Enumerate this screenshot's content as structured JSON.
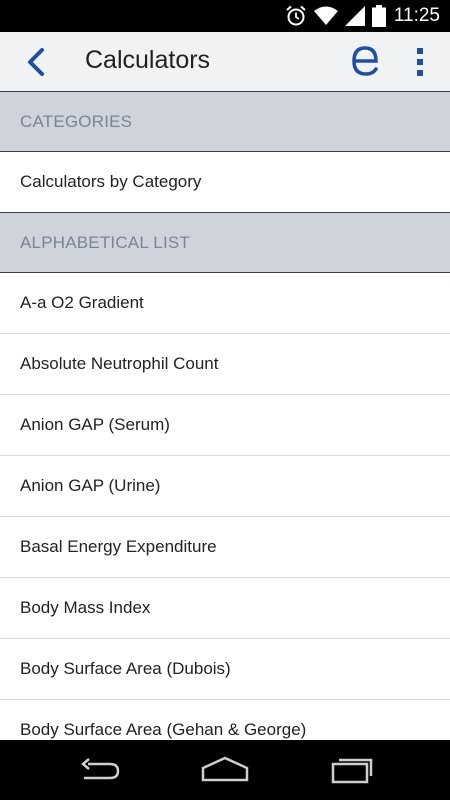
{
  "status_bar": {
    "time": "11:25",
    "icons": [
      "alarm-icon",
      "wifi-icon",
      "signal-icon",
      "battery-icon"
    ]
  },
  "app_bar": {
    "title": "Calculators",
    "back_icon": "chevron-left-icon",
    "brand_icon": "epocrates-e-icon",
    "menu_icon": "overflow-menu-icon",
    "accent_color": "#1f4fa0"
  },
  "sections": {
    "categories": {
      "header": "CATEGORIES",
      "items": [
        "Calculators by Category"
      ]
    },
    "alphabetical": {
      "header": "ALPHABETICAL LIST",
      "items": [
        "A-a O2 Gradient",
        "Absolute Neutrophil Count",
        "Anion GAP (Serum)",
        "Anion GAP (Urine)",
        "Basal Energy Expenditure",
        "Body Mass Index",
        "Body Surface Area (Dubois)",
        "Body Surface Area (Gehan & George)"
      ]
    }
  },
  "nav_bar": {
    "icons": [
      "back-nav-icon",
      "home-nav-icon",
      "recent-apps-icon"
    ]
  }
}
